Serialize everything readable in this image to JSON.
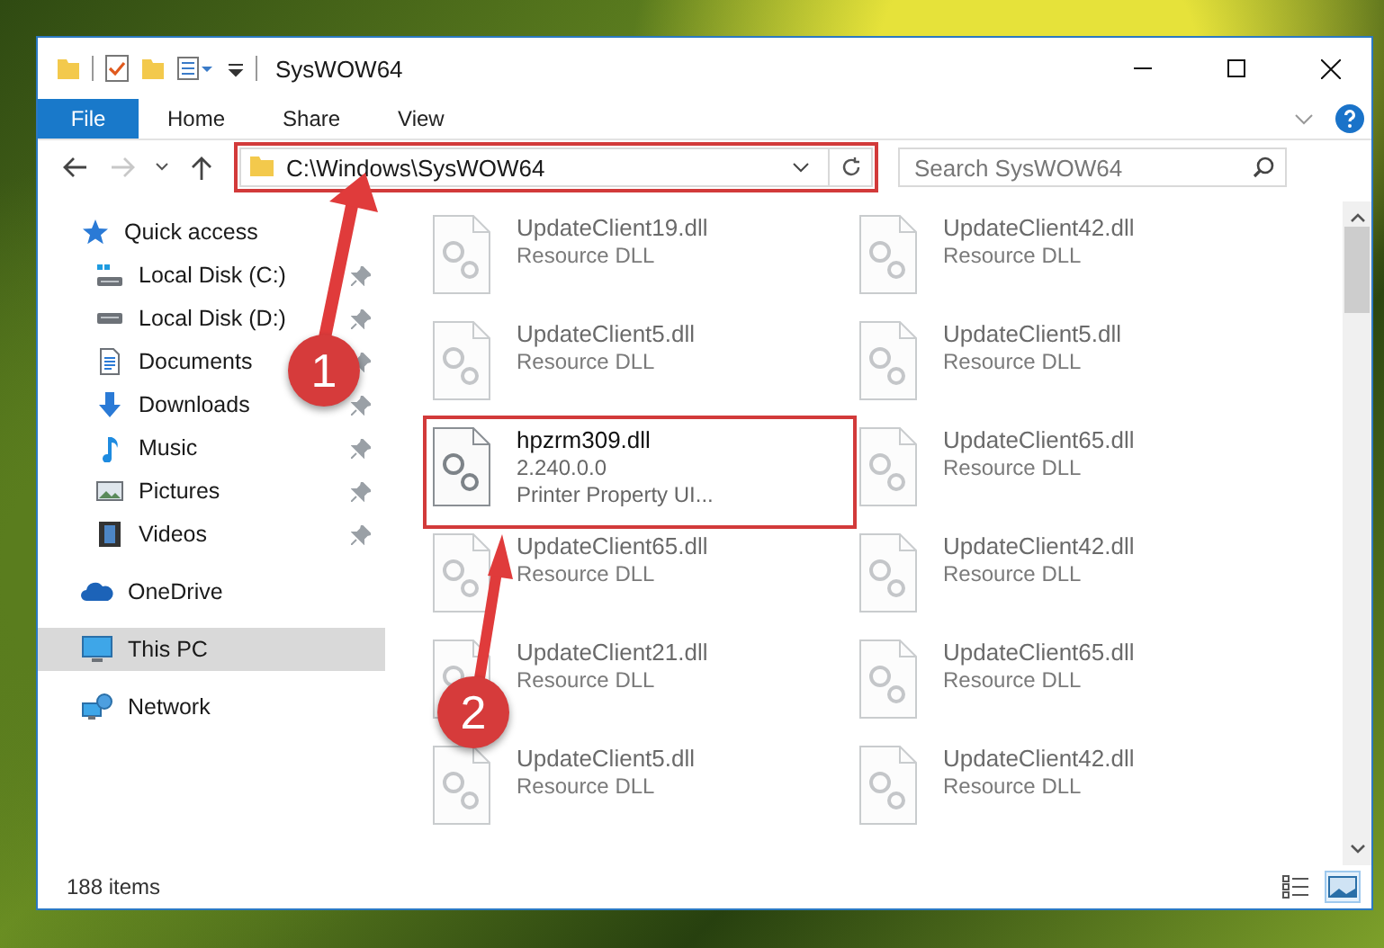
{
  "window": {
    "title": "SysWOW64"
  },
  "ribbon_tabs": [
    {
      "label": "File",
      "kind": "file"
    },
    {
      "label": "Home",
      "kind": "tab"
    },
    {
      "label": "Share",
      "kind": "tab"
    },
    {
      "label": "View",
      "kind": "tab"
    }
  ],
  "navigation": {
    "forward_disabled": true
  },
  "address": {
    "path": "C:\\Windows\\SysWOW64",
    "highlighted": true
  },
  "search": {
    "placeholder": "Search SysWOW64"
  },
  "sidebar": {
    "items": [
      {
        "label": "Quick access",
        "kind": "star",
        "selected": false,
        "children": [
          {
            "label": "Local Disk (C:)",
            "kind": "system-drive",
            "pinned": true,
            "selected": false
          },
          {
            "label": "Local Disk (D:)",
            "kind": "drive",
            "pinned": true,
            "selected": false
          },
          {
            "label": "Documents",
            "kind": "document",
            "pinned": true,
            "selected": false
          },
          {
            "label": "Downloads",
            "kind": "download",
            "pinned": true,
            "selected": false
          },
          {
            "label": "Music",
            "kind": "music",
            "pinned": true,
            "selected": false
          },
          {
            "label": "Pictures",
            "kind": "picture",
            "pinned": true,
            "selected": false
          },
          {
            "label": "Videos",
            "kind": "video",
            "pinned": true,
            "selected": false
          }
        ]
      },
      {
        "label": "OneDrive",
        "kind": "cloud",
        "selected": false
      },
      {
        "label": "This PC",
        "kind": "computer",
        "selected": true
      },
      {
        "label": "Network",
        "kind": "network",
        "selected": false
      }
    ]
  },
  "files": [
    {
      "name": "UpdateClient19.dll",
      "details": [
        "Resource DLL"
      ],
      "faded": true
    },
    {
      "name": "UpdateClient42.dll",
      "details": [
        "Resource DLL"
      ],
      "faded": true
    },
    {
      "name": "UpdateClient5.dll",
      "details": [
        "Resource DLL"
      ],
      "faded": true
    },
    {
      "name": "UpdateClient5.dll",
      "details": [
        "Resource DLL"
      ],
      "faded": true
    },
    {
      "name": "hpzrm309.dll",
      "details": [
        "2.240.0.0",
        "Printer Property UI..."
      ],
      "faded": false,
      "highlighted": true
    },
    {
      "name": "UpdateClient65.dll",
      "details": [
        "Resource DLL"
      ],
      "faded": true
    },
    {
      "name": "UpdateClient65.dll",
      "details": [
        "Resource DLL"
      ],
      "faded": true
    },
    {
      "name": "UpdateClient42.dll",
      "details": [
        "Resource DLL"
      ],
      "faded": true
    },
    {
      "name": "UpdateClient21.dll",
      "details": [
        "Resource DLL"
      ],
      "faded": true
    },
    {
      "name": "UpdateClient65.dll",
      "details": [
        "Resource DLL"
      ],
      "faded": true
    },
    {
      "name": "UpdateClient5.dll",
      "details": [
        "Resource DLL"
      ],
      "faded": true
    },
    {
      "name": "UpdateClient42.dll",
      "details": [
        "Resource DLL"
      ],
      "faded": true
    }
  ],
  "status_bar": {
    "item_count": "188 items"
  },
  "view_buttons": [
    {
      "kind": "details",
      "selected": false
    },
    {
      "kind": "large-icons",
      "selected": true
    }
  ],
  "annotations": [
    {
      "number": "1"
    },
    {
      "number": "2"
    }
  ]
}
